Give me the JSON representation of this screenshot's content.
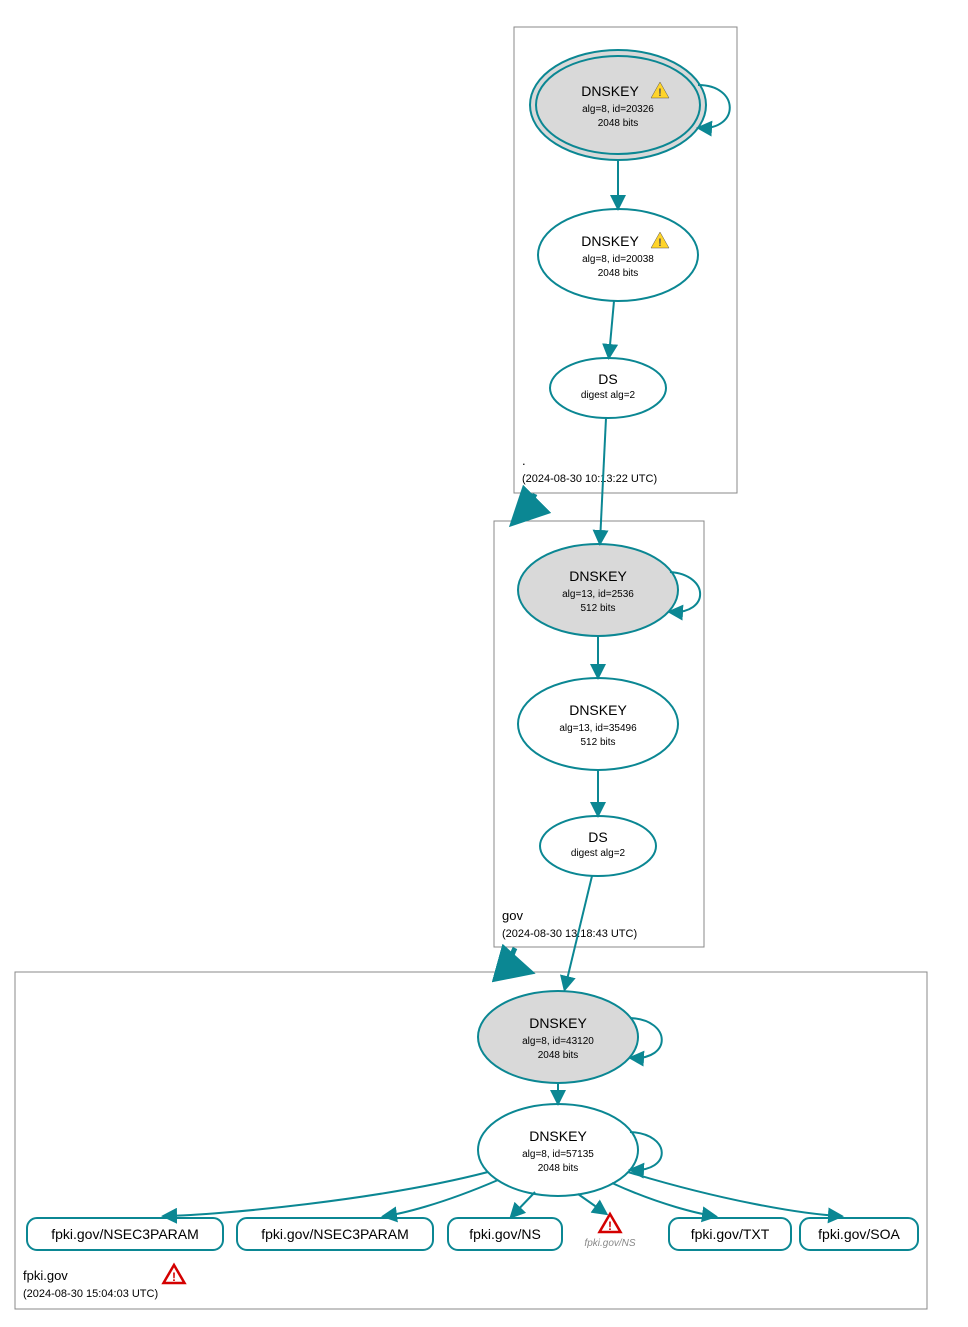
{
  "zones": {
    "root": {
      "name": ".",
      "ts": "(2024-08-30 10:13:22 UTC)"
    },
    "gov": {
      "name": "gov",
      "ts": "(2024-08-30 13:18:43 UTC)"
    },
    "fpki": {
      "name": "fpki.gov",
      "ts": "(2024-08-30 15:04:03 UTC)"
    }
  },
  "nodes": {
    "root_ksk": {
      "title": "DNSKEY",
      "sub1": "alg=8, id=20326",
      "sub2": "2048 bits"
    },
    "root_zsk": {
      "title": "DNSKEY",
      "sub1": "alg=8, id=20038",
      "sub2": "2048 bits"
    },
    "root_ds": {
      "title": "DS",
      "sub1": "digest alg=2"
    },
    "gov_ksk": {
      "title": "DNSKEY",
      "sub1": "alg=13, id=2536",
      "sub2": "512 bits"
    },
    "gov_zsk": {
      "title": "DNSKEY",
      "sub1": "alg=13, id=35496",
      "sub2": "512 bits"
    },
    "gov_ds": {
      "title": "DS",
      "sub1": "digest alg=2"
    },
    "fpki_ksk": {
      "title": "DNSKEY",
      "sub1": "alg=8, id=43120",
      "sub2": "2048 bits"
    },
    "fpki_zsk": {
      "title": "DNSKEY",
      "sub1": "alg=8, id=57135",
      "sub2": "2048 bits"
    },
    "rr1": {
      "label": "fpki.gov/NSEC3PARAM"
    },
    "rr2": {
      "label": "fpki.gov/NSEC3PARAM"
    },
    "rr3": {
      "label": "fpki.gov/NS"
    },
    "rr4": {
      "label": "fpki.gov/NS"
    },
    "rr5": {
      "label": "fpki.gov/TXT"
    },
    "rr6": {
      "label": "fpki.gov/SOA"
    }
  }
}
